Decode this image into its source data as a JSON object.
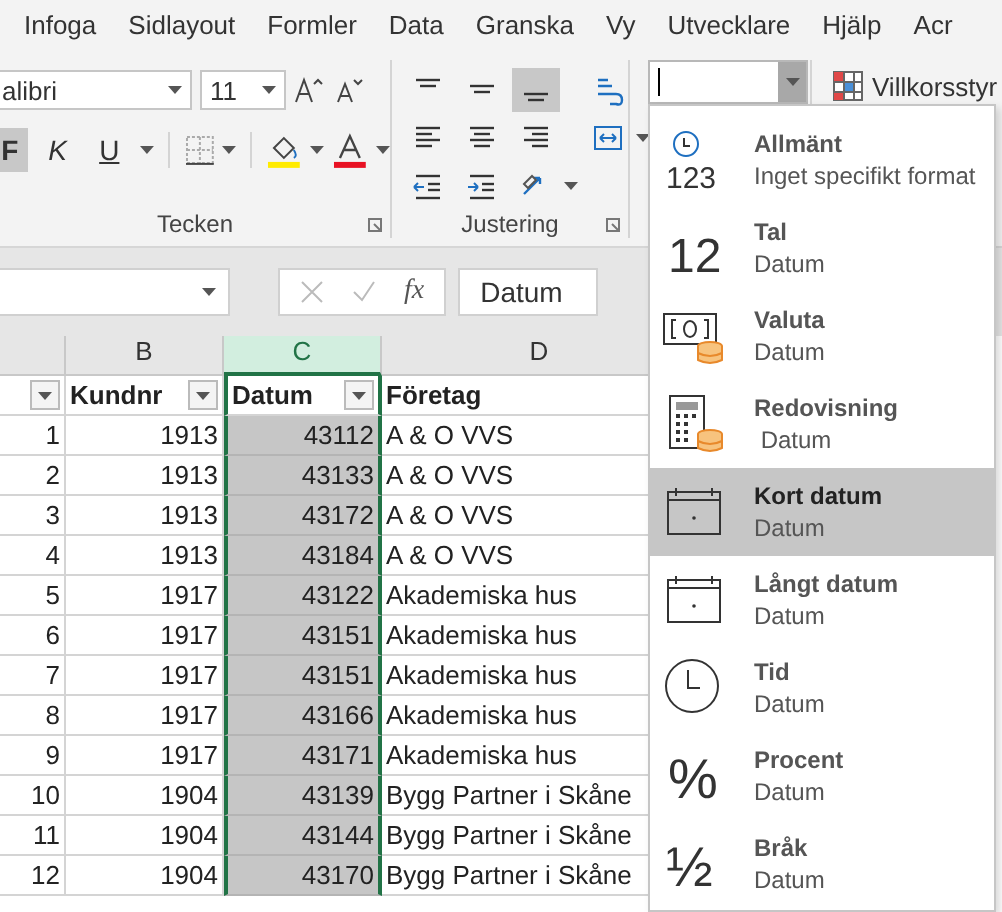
{
  "tabs": [
    {
      "label": "Infoga"
    },
    {
      "label": "Sidlayout"
    },
    {
      "label": "Formler"
    },
    {
      "label": "Data"
    },
    {
      "label": "Granska"
    },
    {
      "label": "Vy"
    },
    {
      "label": "Utvecklare"
    },
    {
      "label": "Hjälp"
    },
    {
      "label": "Acr"
    }
  ],
  "font_group": {
    "font_name": "alibri",
    "font_size": "11",
    "bold": {
      "label": "F",
      "pressed": true
    },
    "italic": {
      "label": "K",
      "pressed": false
    },
    "underline": {
      "label": "U",
      "pressed": false
    },
    "label": "Tecken"
  },
  "alignment_group": {
    "label": "Justering",
    "buttons": [
      {
        "kind": "top",
        "pressed": false
      },
      {
        "kind": "middle",
        "pressed": false
      },
      {
        "kind": "bottom",
        "pressed": true
      },
      {
        "kind": "wrap",
        "pressed": false
      },
      {
        "kind": "left",
        "pressed": false
      },
      {
        "kind": "center",
        "pressed": false
      },
      {
        "kind": "right",
        "pressed": false
      },
      {
        "kind": "merge",
        "pressed": false
      },
      {
        "kind": "outdent",
        "pressed": false
      },
      {
        "kind": "indent",
        "pressed": false
      },
      {
        "kind": "orientation",
        "pressed": false
      }
    ]
  },
  "conditional_formatting": {
    "label": "Villkorsstyr"
  },
  "formula_bar": {
    "function_label": "fx",
    "content": "Datum"
  },
  "sheet": {
    "columns": [
      {
        "selected": false
      },
      {
        "letter": "B",
        "selected": false
      },
      {
        "letter": "C",
        "selected": true
      },
      {
        "letter": "D",
        "selected": false
      }
    ],
    "header": [
      {
        "filter": true
      },
      {
        "label": "Kundnr",
        "filter": true
      },
      {
        "label": "Datum",
        "filter": true
      },
      {
        "label": "Företag",
        "filter": false
      }
    ],
    "rows": [
      [
        "1",
        "1913",
        "43112",
        "A & O VVS"
      ],
      [
        "2",
        "1913",
        "43133",
        "A & O VVS"
      ],
      [
        "3",
        "1913",
        "43172",
        "A & O VVS"
      ],
      [
        "4",
        "1913",
        "43184",
        "A & O VVS"
      ],
      [
        "5",
        "1917",
        "43122",
        "Akademiska hus"
      ],
      [
        "6",
        "1917",
        "43151",
        "Akademiska hus"
      ],
      [
        "7",
        "1917",
        "43151",
        "Akademiska hus"
      ],
      [
        "8",
        "1917",
        "43166",
        "Akademiska hus"
      ],
      [
        "9",
        "1917",
        "43171",
        "Akademiska hus"
      ],
      [
        "10",
        "1904",
        "43139",
        "Bygg Partner i Skåne"
      ],
      [
        "11",
        "1904",
        "43144",
        "Bygg Partner i Skåne"
      ],
      [
        "12",
        "1904",
        "43170",
        "Bygg Partner i Skåne"
      ]
    ]
  },
  "format_menu": {
    "items": [
      {
        "kind": "general",
        "icon_text": "123",
        "title": "Allmänt",
        "description": "Inget specifikt format",
        "selected": false
      },
      {
        "kind": "number",
        "icon_text": "12",
        "title": "Tal",
        "description": "Datum",
        "selected": false
      },
      {
        "kind": "currency",
        "title": "Valuta",
        "description": "Datum",
        "selected": false
      },
      {
        "kind": "accounting",
        "title": "Redovisning",
        "description": " Datum",
        "selected": false
      },
      {
        "kind": "short_date",
        "title": "Kort datum",
        "description": "Datum",
        "selected": true
      },
      {
        "kind": "long_date",
        "title": "Långt datum",
        "description": "Datum",
        "selected": false
      },
      {
        "kind": "time",
        "title": "Tid",
        "description": "Datum",
        "selected": false
      },
      {
        "kind": "percent",
        "icon_text": "%",
        "title": "Procent",
        "description": "Datum",
        "selected": false
      },
      {
        "kind": "fraction",
        "icon_text": "½",
        "title": "Bråk",
        "description": "Datum",
        "selected": false
      }
    ]
  }
}
